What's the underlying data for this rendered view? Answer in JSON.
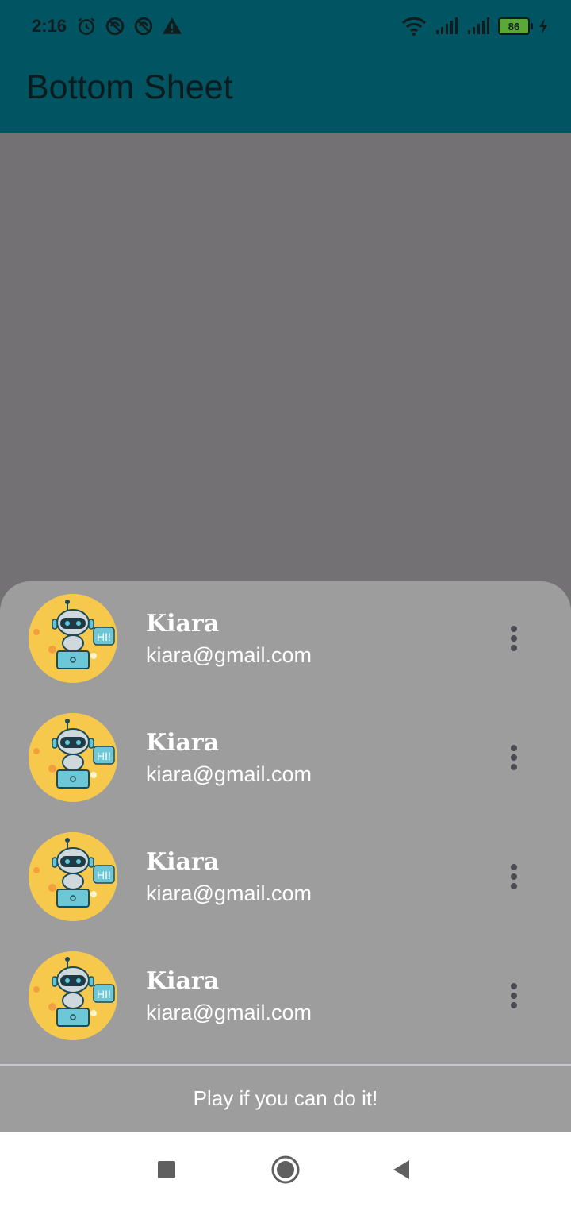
{
  "status_bar": {
    "time": "2:16",
    "battery_level": "86",
    "left_icons": [
      "alarm-icon",
      "do-not-disturb-icon",
      "data-saver-icon",
      "warning-icon"
    ],
    "right_icons": [
      "wifi-icon",
      "signal-icon-1",
      "signal-icon-2",
      "battery-icon",
      "charging-icon"
    ]
  },
  "app_bar": {
    "title": "Bottom Sheet",
    "color": "#015462"
  },
  "sheet": {
    "items": [
      {
        "name": "Kiara",
        "email": "kiara@gmail.com",
        "avatar": "robot-hi-avatar"
      },
      {
        "name": "Kiara",
        "email": "kiara@gmail.com",
        "avatar": "robot-hi-avatar"
      },
      {
        "name": "Kiara",
        "email": "kiara@gmail.com",
        "avatar": "robot-hi-avatar"
      },
      {
        "name": "Kiara",
        "email": "kiara@gmail.com",
        "avatar": "robot-hi-avatar"
      }
    ],
    "footer_label": "Play if you can do it!",
    "avatar_speech_text": "HI!"
  },
  "nav_bar": {
    "buttons": [
      "recents-icon",
      "home-icon",
      "back-icon"
    ]
  }
}
